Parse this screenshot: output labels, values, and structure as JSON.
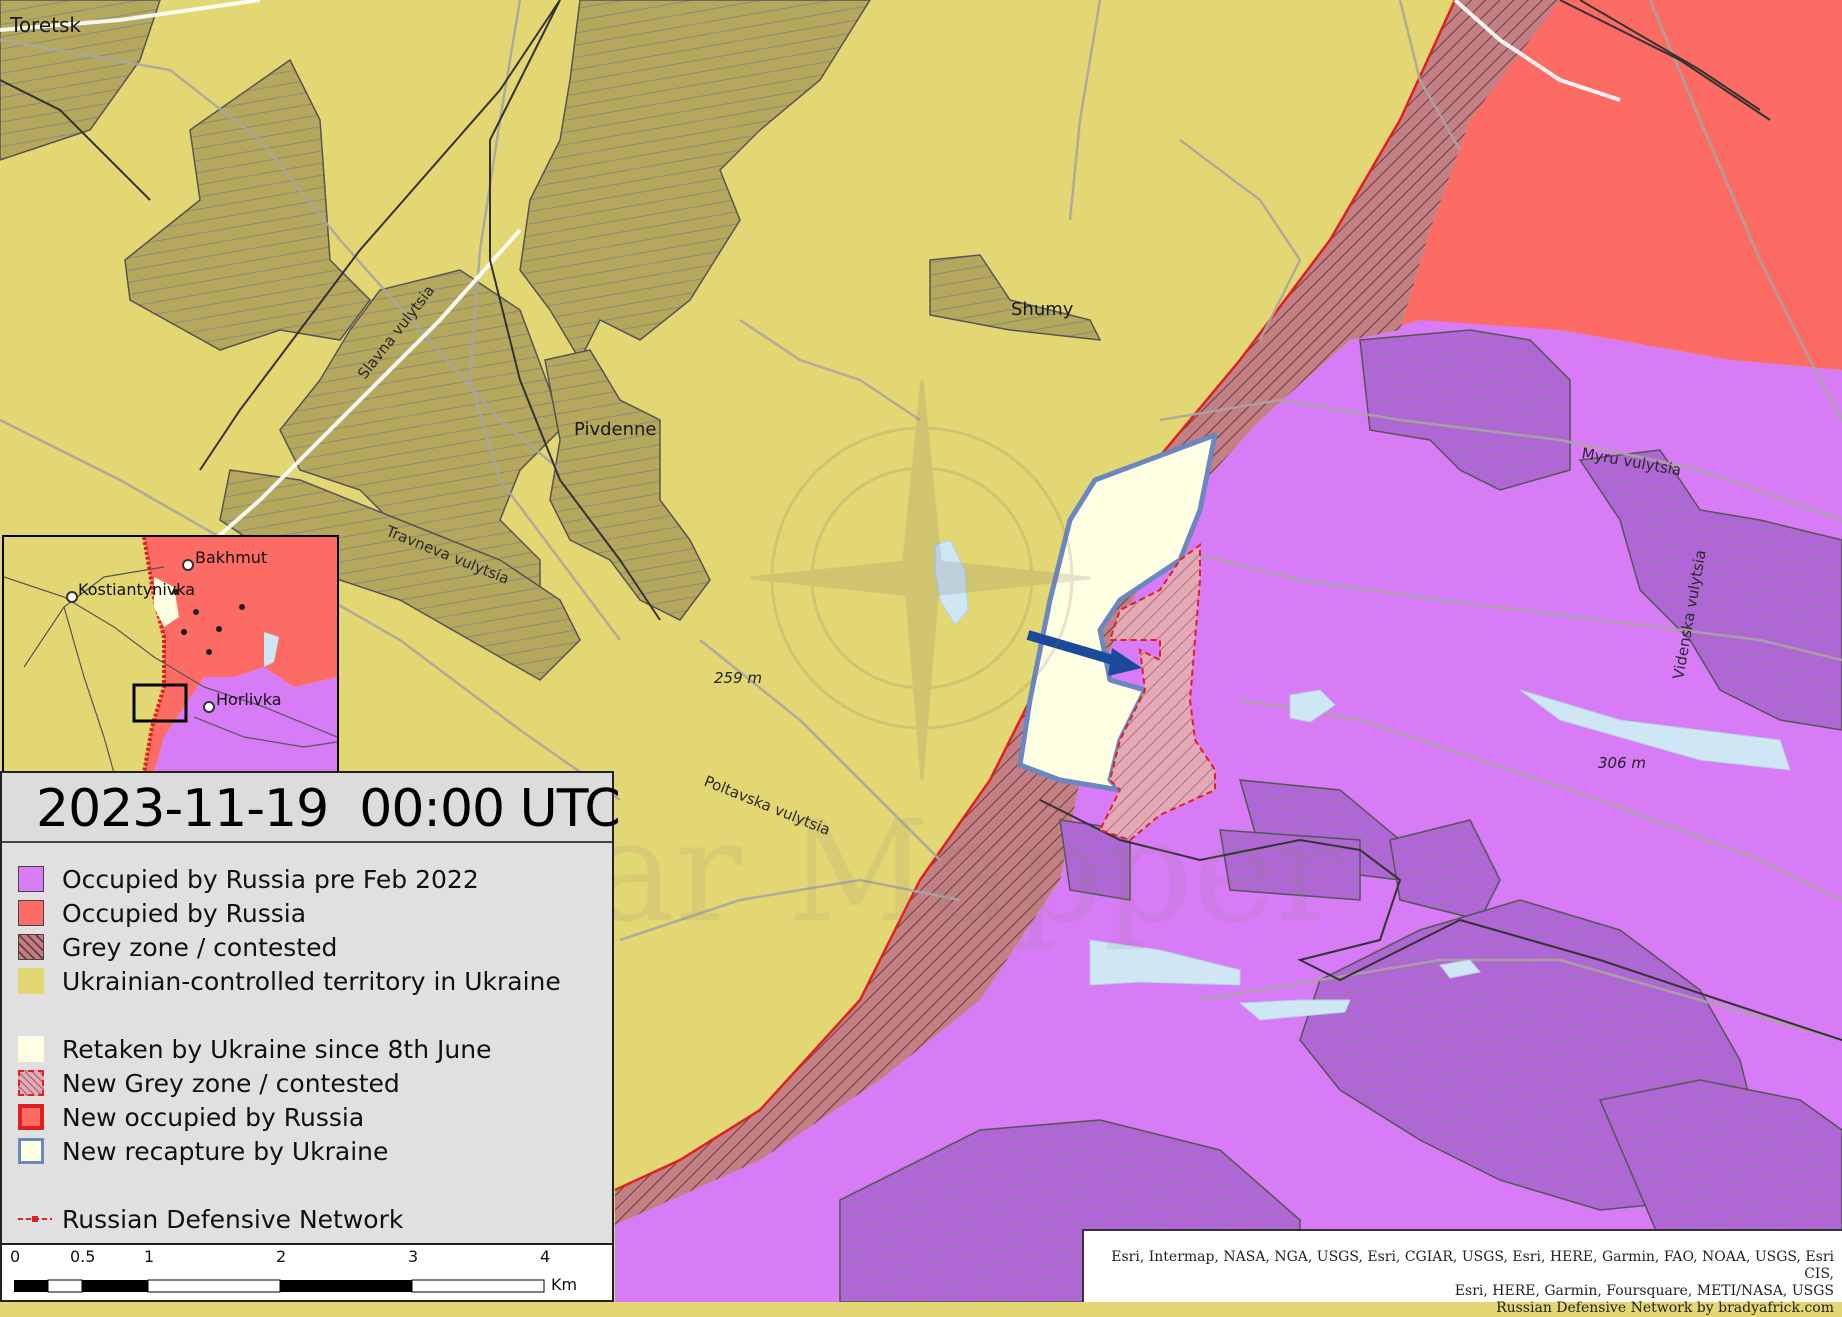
{
  "colors": {
    "ukraine": "#e3d774",
    "occupied_pre2022": "#d77bf6",
    "occupied": "#fd6b65",
    "grey_hatch": "#c07c80",
    "retaken": "#fefee2",
    "new_grey": "#e6a6b3",
    "new_occupied": "#e02020",
    "new_recapture": "#6a87c0",
    "urban_yellow": "#b4a85c",
    "urban_purple": "#b063d4",
    "water": "#cfe6f5",
    "road": "#a9a6a0",
    "arrow": "#1a4b9a"
  },
  "map": {
    "places": {
      "toretsk": "Toretsk",
      "shumy": "Shumy",
      "pivdenne": "Pivdenne"
    },
    "streets": {
      "slavna": "Slavna vulytsia",
      "travneva": "Travneva vulytsia",
      "poltavska": "Poltavska vulytsia",
      "myru": "Myru vulytsia",
      "videnska": "Videnska vulytsia"
    },
    "elevations": {
      "e259": "259 m",
      "e306": "306 m"
    },
    "watermark": "War Mapper"
  },
  "inset": {
    "places": {
      "bakhmut": "Bakhmut",
      "kostiantynivka": "Kostiantynivka",
      "horlivka": "Horlivka"
    }
  },
  "legend": {
    "datetime": "2023-11-19  00:00 UTC",
    "items": [
      {
        "label": "Occupied by Russia pre Feb 2022",
        "swatch": "pre2022"
      },
      {
        "label": "Occupied by Russia",
        "swatch": "occupied"
      },
      {
        "label": "Grey zone / contested",
        "swatch": "grey"
      },
      {
        "label": "Ukrainian-controlled territory in Ukraine",
        "swatch": "ukraine"
      },
      {
        "label": "Retaken by Ukraine since 8th June",
        "swatch": "retaken"
      },
      {
        "label": "New Grey zone / contested",
        "swatch": "newgrey"
      },
      {
        "label": "New occupied by Russia",
        "swatch": "newocc"
      },
      {
        "label": "New recapture by Ukraine",
        "swatch": "recapture"
      },
      {
        "label": "Russian Defensive Network",
        "swatch": "defensive"
      }
    ]
  },
  "scale_bar": {
    "ticks": [
      "0",
      "0.5",
      "1",
      "2",
      "3",
      "4"
    ],
    "unit": "Km"
  },
  "credits": {
    "line1": "Esri, Intermap, NASA, NGA, USGS, Esri, CGIAR, USGS, Esri, HERE, Garmin, FAO, NOAA, USGS, Esri CIS,",
    "line2": "Esri, HERE, Garmin, Foursquare, METI/NASA, USGS",
    "line3": "Russian Defensive Network by bradyafrick.com"
  }
}
